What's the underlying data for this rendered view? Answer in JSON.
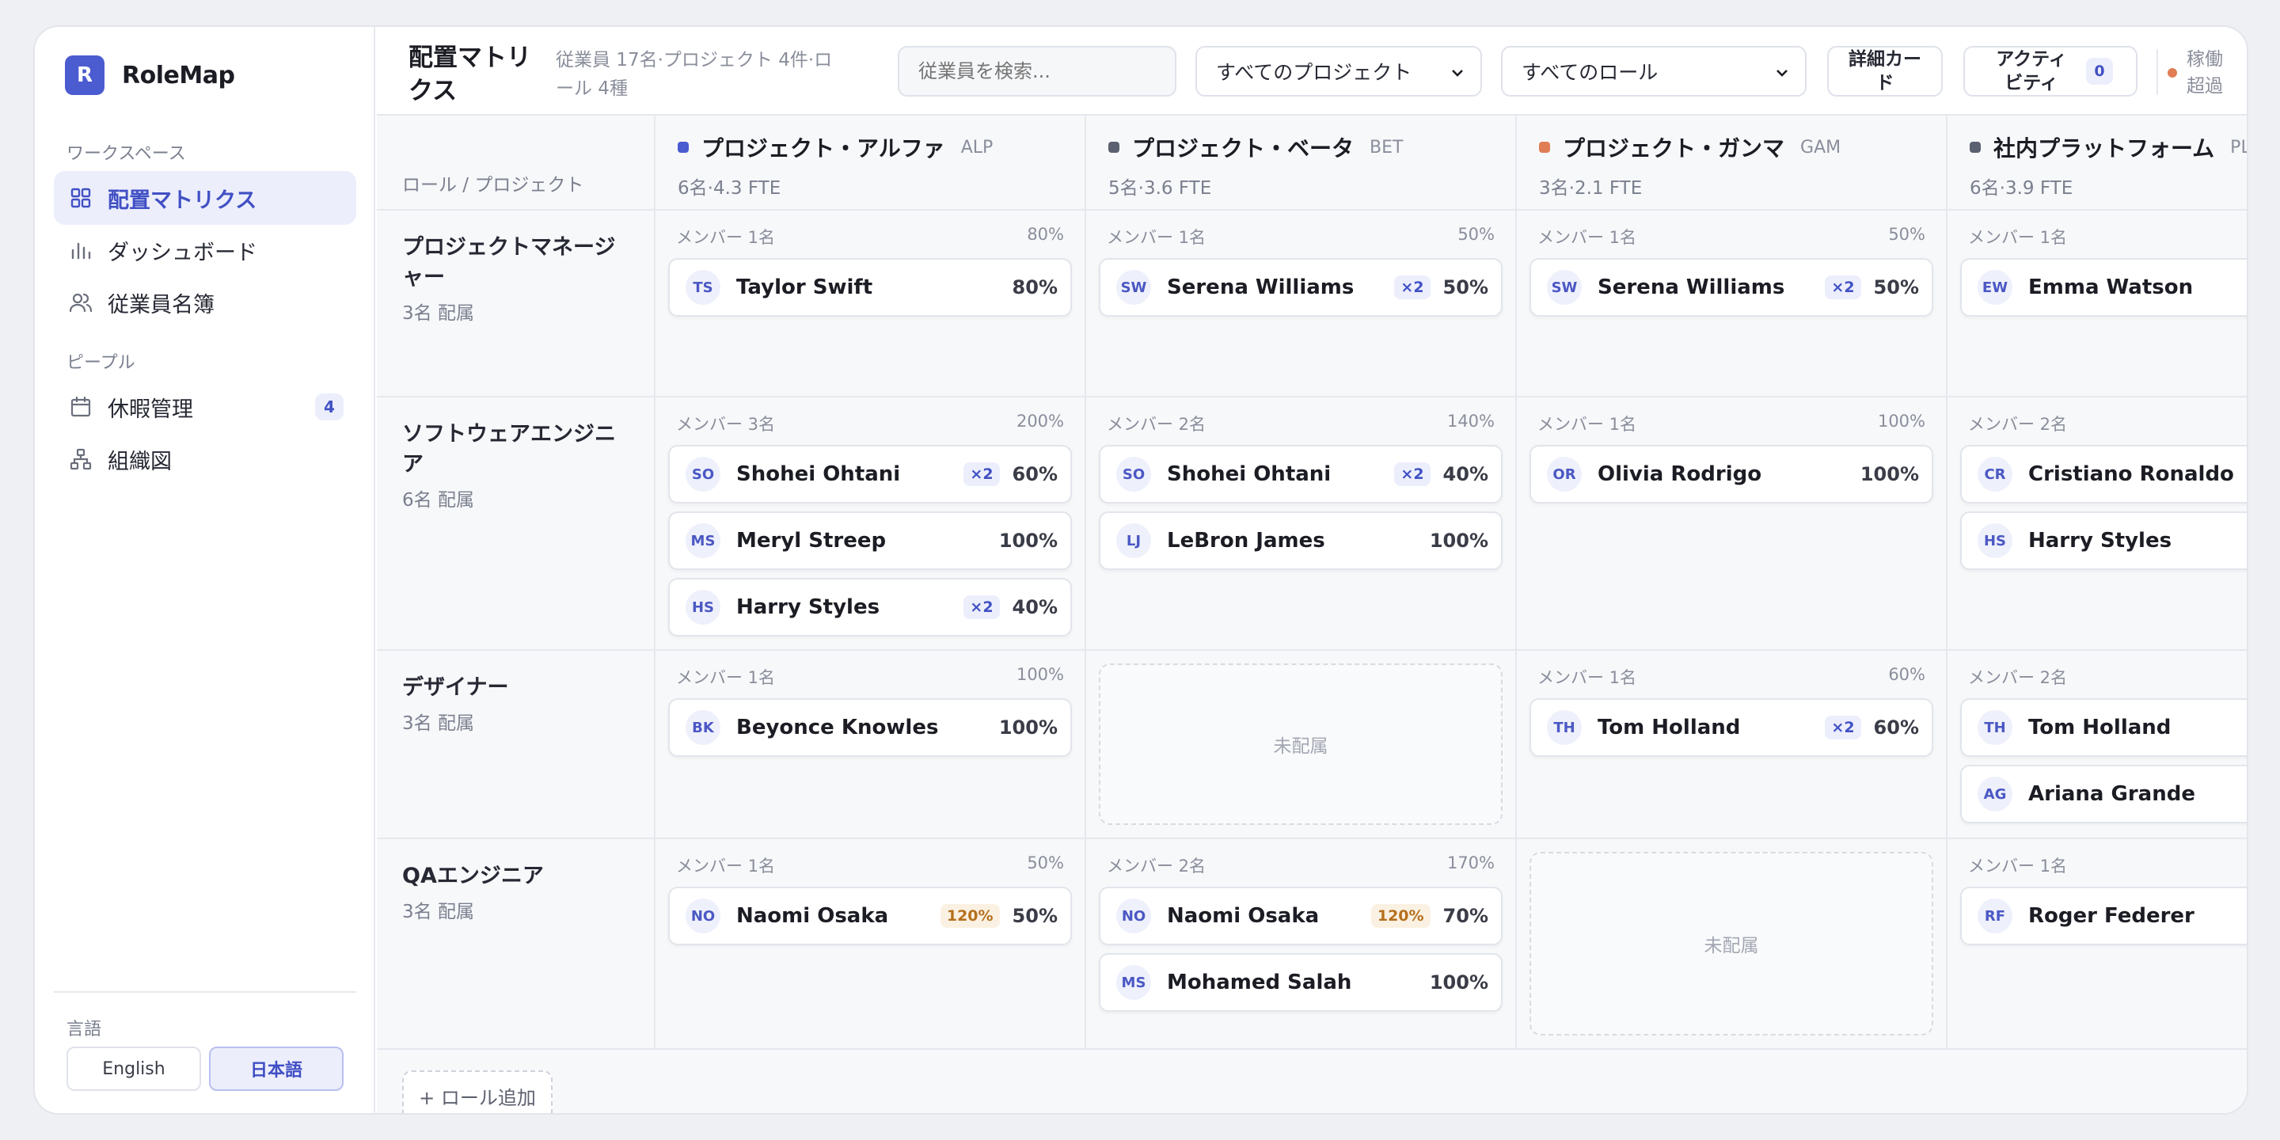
{
  "brand": {
    "logo_letter": "R",
    "name": "RoleMap"
  },
  "sidebar": {
    "workspace_label": "ワークスペース",
    "workspace_items": [
      {
        "label": "配置マトリクス",
        "icon": "grid-icon",
        "active": true
      },
      {
        "label": "ダッシュボード",
        "icon": "bar-chart-icon"
      },
      {
        "label": "従業員名簿",
        "icon": "users-icon"
      }
    ],
    "people_label": "ピープル",
    "people_items": [
      {
        "label": "休暇管理",
        "icon": "calendar-icon",
        "badge": "4"
      },
      {
        "label": "組織図",
        "icon": "org-chart-icon"
      }
    ],
    "language_label": "言語",
    "languages": [
      {
        "label": "English",
        "active": false
      },
      {
        "label": "日本語",
        "active": true
      }
    ]
  },
  "header": {
    "title": "配置マトリクス",
    "subtitle": "従業員 17名·プロジェクト 4件·ロール 4種",
    "search_placeholder": "従業員を検索...",
    "project_filter": "すべてのプロジェクト",
    "role_filter": "すべてのロール",
    "detail_card_button": "詳細カード",
    "activity_button": "アクティビティ",
    "activity_count": "0",
    "overload_legend": "稼働超過",
    "overload_color": "#e07d55"
  },
  "matrix": {
    "corner_label": "ロール / プロジェクト",
    "projects": [
      {
        "name": "プロジェクト・アルファ",
        "code": "ALP",
        "meta": "6名·4.3 FTE",
        "color": "#4b5bd0"
      },
      {
        "name": "プロジェクト・ベータ",
        "code": "BET",
        "meta": "5名·3.6 FTE",
        "color": "#5b6170"
      },
      {
        "name": "プロジェクト・ガンマ",
        "code": "GAM",
        "meta": "3名·2.1 FTE",
        "color": "#e07d55"
      },
      {
        "name": "社内プラットフォーム",
        "code": "PLT",
        "meta": "6名·3.9 FTE",
        "color": "#5b6170"
      }
    ],
    "roles": [
      {
        "name": "プロジェクトマネージャー",
        "count": "3名 配属"
      },
      {
        "name": "ソフトウェアエンジニア",
        "count": "6名 配属"
      },
      {
        "name": "デザイナー",
        "count": "3名 配属"
      },
      {
        "name": "QAエンジニア",
        "count": "3名 配属"
      }
    ],
    "cells": [
      [
        {
          "members": "メンバー 1名",
          "total": "80%",
          "cards": [
            {
              "initials": "TS",
              "name": "Taylor Swift",
              "alloc": "80%"
            }
          ]
        },
        {
          "members": "メンバー 1名",
          "total": "50%",
          "cards": [
            {
              "initials": "SW",
              "name": "Serena Williams",
              "multi": "×2",
              "alloc": "50%"
            }
          ]
        },
        {
          "members": "メンバー 1名",
          "total": "50%",
          "cards": [
            {
              "initials": "SW",
              "name": "Serena Williams",
              "multi": "×2",
              "alloc": "50%"
            }
          ]
        },
        {
          "members": "メンバー 1名",
          "total": "",
          "cards": [
            {
              "initials": "EW",
              "name": "Emma Watson",
              "alloc": ""
            }
          ]
        }
      ],
      [
        {
          "members": "メンバー 3名",
          "total": "200%",
          "cards": [
            {
              "initials": "SO",
              "name": "Shohei Ohtani",
              "multi": "×2",
              "alloc": "60%"
            },
            {
              "initials": "MS",
              "name": "Meryl Streep",
              "alloc": "100%"
            },
            {
              "initials": "HS",
              "name": "Harry Styles",
              "multi": "×2",
              "alloc": "40%"
            }
          ]
        },
        {
          "members": "メンバー 2名",
          "total": "140%",
          "cards": [
            {
              "initials": "SO",
              "name": "Shohei Ohtani",
              "multi": "×2",
              "alloc": "40%"
            },
            {
              "initials": "LJ",
              "name": "LeBron James",
              "alloc": "100%"
            }
          ]
        },
        {
          "members": "メンバー 1名",
          "total": "100%",
          "cards": [
            {
              "initials": "OR",
              "name": "Olivia Rodrigo",
              "alloc": "100%"
            }
          ]
        },
        {
          "members": "メンバー 2名",
          "total": "",
          "cards": [
            {
              "initials": "CR",
              "name": "Cristiano Ronaldo",
              "alloc": ""
            },
            {
              "initials": "HS",
              "name": "Harry Styles",
              "alloc": ""
            }
          ]
        }
      ],
      [
        {
          "members": "メンバー 1名",
          "total": "100%",
          "cards": [
            {
              "initials": "BK",
              "name": "Beyonce Knowles",
              "alloc": "100%"
            }
          ]
        },
        {
          "empty": "未配属"
        },
        {
          "members": "メンバー 1名",
          "total": "60%",
          "cards": [
            {
              "initials": "TH",
              "name": "Tom Holland",
              "multi": "×2",
              "alloc": "60%"
            }
          ]
        },
        {
          "members": "メンバー 2名",
          "total": "",
          "cards": [
            {
              "initials": "TH",
              "name": "Tom Holland",
              "alloc": ""
            },
            {
              "initials": "AG",
              "name": "Ariana Grande",
              "alloc": ""
            }
          ]
        }
      ],
      [
        {
          "members": "メンバー 1名",
          "total": "50%",
          "cards": [
            {
              "initials": "NO",
              "name": "Naomi Osaka",
              "over": "120%",
              "alloc": "50%"
            }
          ]
        },
        {
          "members": "メンバー 2名",
          "total": "170%",
          "cards": [
            {
              "initials": "NO",
              "name": "Naomi Osaka",
              "over": "120%",
              "alloc": "70%"
            },
            {
              "initials": "MS",
              "name": "Mohamed Salah",
              "alloc": "100%"
            }
          ]
        },
        {
          "empty": "未配属"
        },
        {
          "members": "メンバー 1名",
          "total": "",
          "cards": [
            {
              "initials": "RF",
              "name": "Roger Federer",
              "alloc": ""
            }
          ]
        }
      ]
    ],
    "add_role_button": "+ ロール追加"
  }
}
